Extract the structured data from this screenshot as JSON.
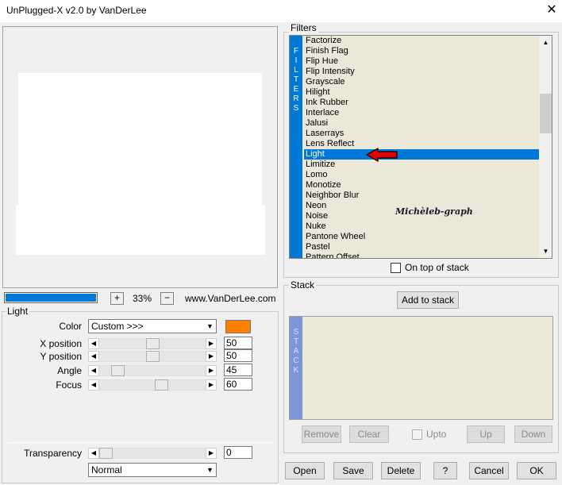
{
  "window": {
    "title": "UnPlugged-X v2.0 by VanDerLee",
    "close_glyph": "✕"
  },
  "preview": {
    "progress_fraction": 1.0,
    "zoom_plus": "+",
    "zoom_value": "33%",
    "zoom_minus": "−",
    "website": "www.VanDerLee.com"
  },
  "light": {
    "legend": "Light",
    "color_label": "Color",
    "color_value": "Custom >>>",
    "color_swatch": "#ff7f00",
    "params": [
      {
        "label": "X position",
        "value": "50",
        "fraction": 0.5
      },
      {
        "label": "Y position",
        "value": "50",
        "fraction": 0.5
      },
      {
        "label": "Angle",
        "value": "45",
        "fraction": 0.125
      },
      {
        "label": "Focus",
        "value": "60",
        "fraction": 0.6
      }
    ],
    "transparency_label": "Transparency",
    "transparency_value": "0",
    "transparency_fraction": 0,
    "blend_mode": "Normal"
  },
  "filters": {
    "legend": "Filters",
    "strip_letters": [
      "F",
      "I",
      "L",
      "T",
      "E",
      "R",
      "S"
    ],
    "items": [
      "Factorize",
      "Finish Flag",
      "Flip Hue",
      "Flip Intensity",
      "Grayscale",
      "Hilight",
      "Ink Rubber",
      "Interlace",
      "Jalusi",
      "Laserrays",
      "Lens Reflect",
      "Light",
      "Limitize",
      "Lomo",
      "Monotize",
      "Neighbor Blur",
      "Neon",
      "Noise",
      "Nuke",
      "Pantone Wheel",
      "Pastel",
      "Pattern Offset"
    ],
    "selected_index": 11,
    "watermark": "Michèleb-graph",
    "on_top_label": "On top of stack"
  },
  "stack": {
    "legend": "Stack",
    "add_label": "Add to stack",
    "strip_letters": [
      "S",
      "T",
      "A",
      "C",
      "K"
    ],
    "remove_label": "Remove",
    "clear_label": "Clear",
    "upto_label": "Upto",
    "up_label": "Up",
    "down_label": "Down"
  },
  "footer": {
    "open": "Open",
    "save": "Save",
    "delete": "Delete",
    "help": "?",
    "cancel": "Cancel",
    "ok": "OK"
  },
  "colors": {
    "accent": "#0078d7",
    "arrow": "#e00000"
  }
}
